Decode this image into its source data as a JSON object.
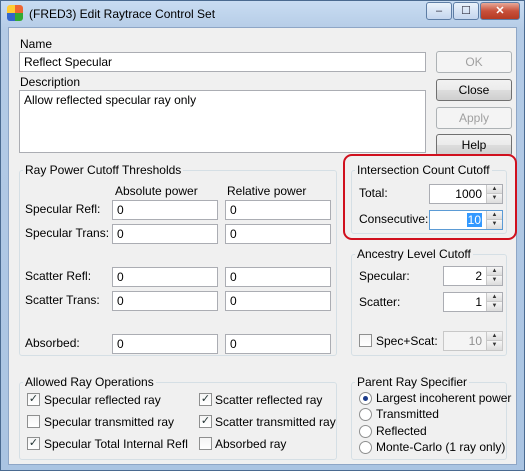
{
  "window": {
    "title": "(FRED3) Edit Raytrace Control Set",
    "caption_buttons": [
      "–",
      "☐",
      "✕"
    ]
  },
  "name": {
    "label": "Name",
    "value": "Reflect Specular"
  },
  "description": {
    "label": "Description",
    "value": "Allow reflected specular ray only"
  },
  "buttons": {
    "ok": "OK",
    "close": "Close",
    "apply": "Apply",
    "help": "Help"
  },
  "power_cutoff": {
    "title": "Ray Power Cutoff Thresholds",
    "col_absolute": "Absolute power",
    "col_relative": "Relative power",
    "rows": [
      {
        "label": "Specular Refl:",
        "absolute": "0",
        "relative": "0"
      },
      {
        "label": "Specular Trans:",
        "absolute": "0",
        "relative": "0"
      },
      {
        "label": "Scatter Refl:",
        "absolute": "0",
        "relative": "0"
      },
      {
        "label": "Scatter Trans:",
        "absolute": "0",
        "relative": "0"
      },
      {
        "label": "Absorbed:",
        "absolute": "0",
        "relative": "0"
      }
    ]
  },
  "intersection": {
    "title": "Intersection Count Cutoff",
    "total_label": "Total:",
    "total_value": "1000",
    "consecutive_label": "Consecutive:",
    "consecutive_value": "10",
    "highlight_color": "#d0101e"
  },
  "ancestry": {
    "title": "Ancestry Level Cutoff",
    "specular_label": "Specular:",
    "specular_value": "2",
    "scatter_label": "Scatter:",
    "scatter_value": "1",
    "spec_scat_label": "Spec+Scat:",
    "spec_scat_checked": false,
    "spec_scat_value": "10"
  },
  "operations": {
    "title": "Allowed Ray Operations",
    "items": [
      {
        "label": "Specular reflected ray",
        "checked": true
      },
      {
        "label": "Scatter reflected ray",
        "checked": true
      },
      {
        "label": "Specular transmitted ray",
        "checked": false
      },
      {
        "label": "Scatter transmitted ray",
        "checked": true
      },
      {
        "label": "Specular Total Internal Refl",
        "checked": true
      },
      {
        "label": "Absorbed ray",
        "checked": false
      }
    ]
  },
  "parent": {
    "title": "Parent Ray Specifier",
    "options": [
      {
        "label": "Largest incoherent power",
        "selected": true
      },
      {
        "label": "Transmitted",
        "selected": false
      },
      {
        "label": "Reflected",
        "selected": false
      },
      {
        "label": "Monte-Carlo (1 ray only)",
        "selected": false
      }
    ]
  }
}
